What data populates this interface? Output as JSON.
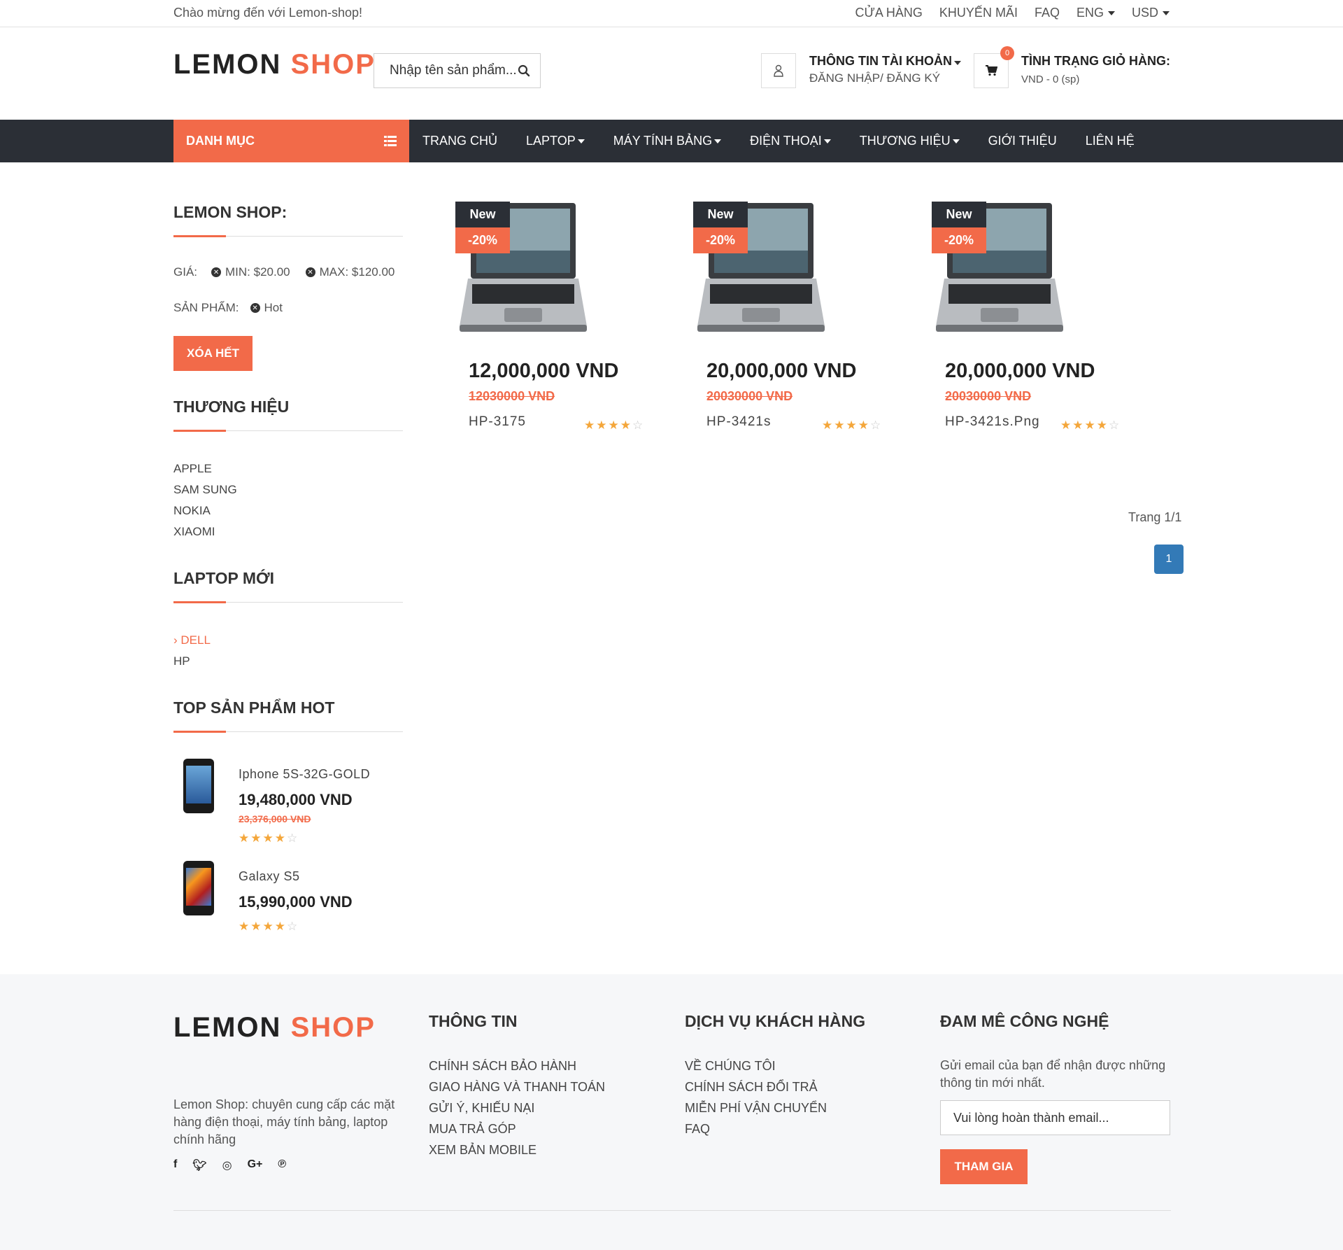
{
  "topbar": {
    "welcome": "Chào mừng đến với Lemon-shop!",
    "links": [
      "CỬA HÀNG",
      "KHUYẾN MÃI",
      "FAQ",
      "ENG",
      "USD"
    ]
  },
  "header": {
    "logo_main": "LEMON",
    "logo_accent": "SHOP",
    "search_placeholder": "Nhập tên sản phẩm...",
    "account_title": "THÔNG TIN TÀI KHOẢN",
    "account_sub": "ĐĂNG NHẬP/ ĐĂNG KÝ",
    "cart_title": "TÌNH TRẠNG GIỎ HÀNG:",
    "cart_sub": "VND - 0 (sp)",
    "cart_count": "0"
  },
  "nav": {
    "category": "DANH MỤC",
    "items": [
      "TRANG CHỦ",
      "LAPTOP",
      "MÁY TÍNH BẢNG",
      "ĐIỆN THOẠI",
      "THƯƠNG HIỆU",
      "GIỚI THIỆU",
      "LIÊN HỆ"
    ]
  },
  "sidebar": {
    "filter_title": "LEMON SHOP:",
    "price_label": "GIÁ:",
    "price_min": "MIN: $20.00",
    "price_max": "MAX: $120.00",
    "product_label": "SẢN PHẨM:",
    "product_tag": "Hot",
    "clear_all": "XÓA HẾT",
    "brand_title": "THƯƠNG HIỆU",
    "brands": [
      "APPLE",
      "SAM SUNG",
      "NOKIA",
      "XIAOMI"
    ],
    "laptop_title": "LAPTOP MỚI",
    "laptops": [
      "DELL",
      "HP"
    ],
    "hot_title": "TOP SẢN PHẨM HOT",
    "hot_items": [
      {
        "name": "Iphone 5S-32G-GOLD",
        "price": "19,480,000 VND",
        "old_price": "23,376,000 VND",
        "rating": 4
      },
      {
        "name": "Galaxy S5",
        "price": "15,990,000 VND",
        "old_price": "",
        "rating": 4
      }
    ]
  },
  "products": [
    {
      "badge_new": "New",
      "badge_sale": "-20%",
      "price": "12,000,000 VND",
      "old_price": "12030000 VND",
      "name": "HP-3175",
      "rating": 4
    },
    {
      "badge_new": "New",
      "badge_sale": "-20%",
      "price": "20,000,000 VND",
      "old_price": "20030000 VND",
      "name": "HP-3421s",
      "rating": 4
    },
    {
      "badge_new": "New",
      "badge_sale": "-20%",
      "price": "20,000,000 VND",
      "old_price": "20030000 VND",
      "name": "HP-3421s.Png",
      "rating": 4
    }
  ],
  "pagination": {
    "info": "Trang 1/1",
    "current": "1"
  },
  "footer": {
    "logo_main": "LEMON",
    "logo_accent": "SHOP",
    "about": "Lemon Shop: chuyên cung cấp các mặt hàng điện thoại, máy tính bảng, laptop chính hãng",
    "info_title": "THÔNG TIN",
    "info_links": [
      "CHÍNH SÁCH BẢO HÀNH",
      "GIAO HÀNG VÀ THANH TOÁN",
      "GỬI Ý, KHIẾU NẠI",
      "MUA TRẢ GÓP",
      "XEM BẢN MOBILE"
    ],
    "service_title": "DỊCH VỤ KHÁCH HÀNG",
    "service_links": [
      "VỀ CHÚNG TÔI",
      "CHÍNH SÁCH ĐỔI TRẢ",
      "MIỄN PHÍ VẬN CHUYỂN",
      "FAQ"
    ],
    "newsletter_title": "ĐAM MÊ CÔNG NGHỆ",
    "newsletter_text": "Gửi email của bạn để nhận được những thông tin mới nhất.",
    "email_placeholder": "Vui lòng hoàn thành email...",
    "join": "THAM GIA",
    "social": [
      "facebook-icon",
      "twitter-icon",
      "instagram-icon",
      "google-plus-icon",
      "pinterest-icon"
    ]
  },
  "colors": {
    "accent": "#f26a49",
    "nav_bg": "#2b2f36",
    "page_btn": "#337ab7",
    "star": "#f4a63a"
  }
}
